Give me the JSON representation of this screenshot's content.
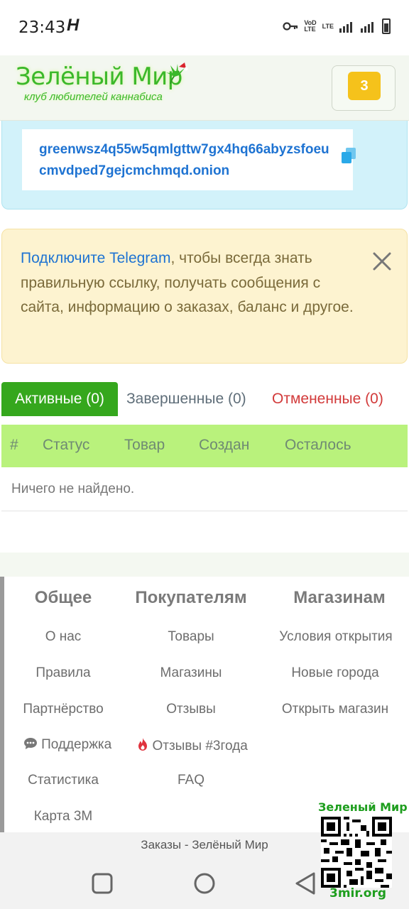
{
  "status_bar": {
    "time": "23:43",
    "h_glyph": "H",
    "volte": "VoD\nLTE",
    "lte": "LTE"
  },
  "header": {
    "logo_title": "Зелёный Мир",
    "logo_subtitle": "клуб любителей каннабиса",
    "cart_count": "3",
    "accent_color": "#3bb82a"
  },
  "onion": {
    "address": "greenwsz4q55w5qmlgttw7gx4hq66abyzsfoeucmvdped7gejcmchmqd.onion",
    "copy_icon": "copy-icon"
  },
  "alert": {
    "link_text": "Подключите Telegram",
    "text": ", чтобы всегда знать правильную ссылку, получать сообщения с сайта, информацию о заказах, баланс и другое.",
    "close_icon": "close-icon"
  },
  "tabs": [
    {
      "label": "Активные (0)",
      "active": true
    },
    {
      "label": "Завершенные (0)",
      "active": false
    },
    {
      "label": "Отмененные (0)",
      "active": false
    }
  ],
  "table": {
    "columns": [
      "#",
      "Статус",
      "Товар",
      "Создан",
      "Осталось"
    ],
    "empty_message": "Ничего не найдено."
  },
  "footer": {
    "columns": [
      {
        "title": "Общее",
        "links": [
          "О нас",
          "Правила",
          "Партнёрство",
          "Поддержка",
          "Статистика",
          "Карта 3М"
        ]
      },
      {
        "title": "Покупателям",
        "links": [
          "Товары",
          "Магазины",
          "Отзывы",
          "Отзывы #3года",
          "FAQ"
        ]
      },
      {
        "title": "Магазинам",
        "links": [
          "Условия открытия",
          "Новые города",
          "Открыть магазин"
        ]
      }
    ]
  },
  "address_bar": {
    "title": "Заказы - Зелёный Мир"
  },
  "watermark": {
    "title": "Зеленый Мир",
    "url": "3mir.org"
  }
}
